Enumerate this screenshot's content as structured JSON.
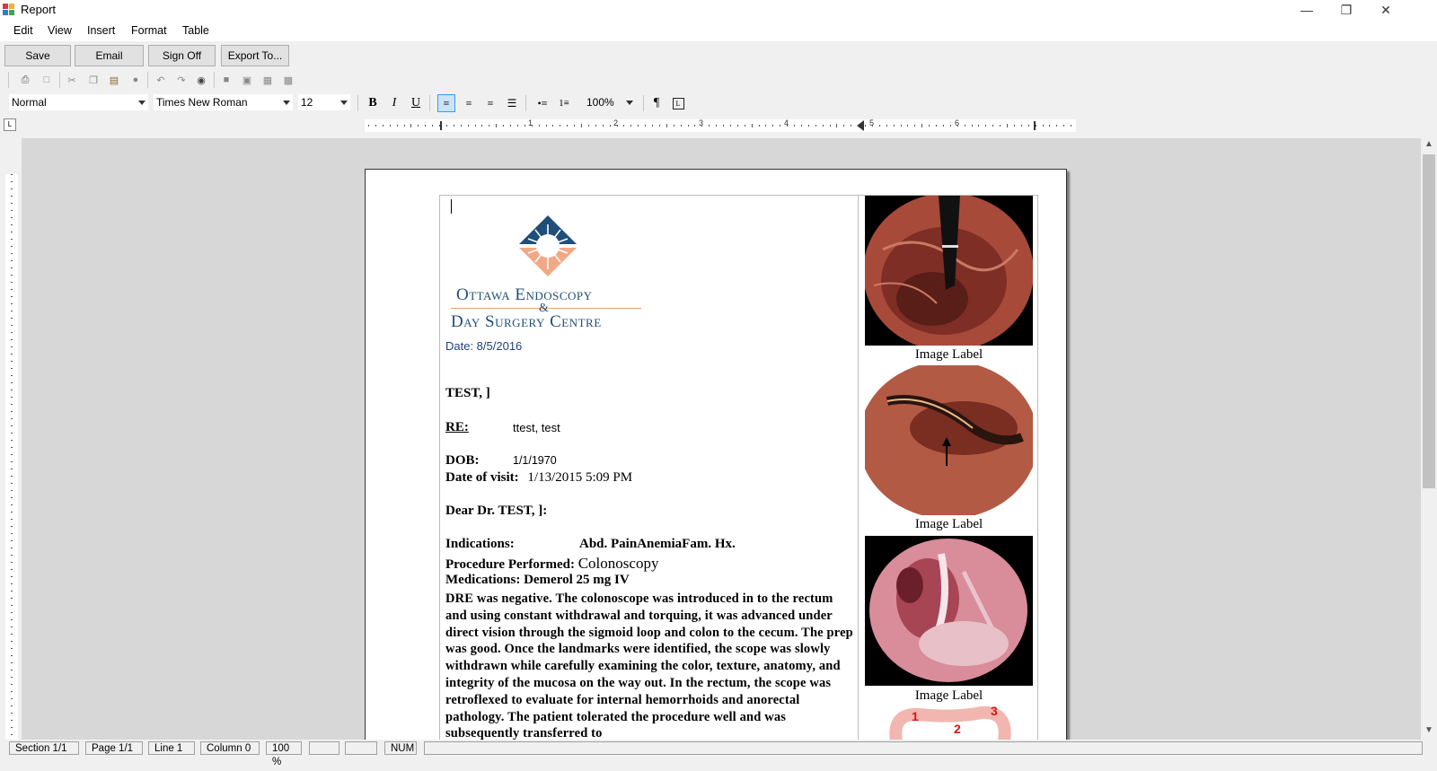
{
  "window": {
    "title": "Report"
  },
  "menu": [
    "Edit",
    "View",
    "Insert",
    "Format",
    "Table"
  ],
  "commands": [
    "Save",
    "Email",
    "Sign Off",
    "Export To..."
  ],
  "format_toolbar": {
    "style": "Normal",
    "font": "Times New Roman",
    "size": "12",
    "zoom": "100%"
  },
  "ruler_numbers": [
    "1",
    "2",
    "3",
    "4",
    "5",
    "6"
  ],
  "letterhead": {
    "line1": "Ottawa Endoscopy",
    "amp": "&",
    "line2": "Day Surgery Centre"
  },
  "report": {
    "date": "Date: 8/5/2016",
    "patient": "TEST, ]",
    "re_label": "RE:",
    "re_value": "ttest, test",
    "dob_label": "DOB:",
    "dob_value": "1/1/1970",
    "visit_label": "Date of visit:",
    "visit_value": "1/13/2015 5:09 PM",
    "greeting": "Dear Dr. TEST, ]:",
    "indications_label": "Indications:",
    "indications_value": "Abd. PainAnemiaFam. Hx.",
    "procedure_label": "Procedure Performed:",
    "procedure_value": "Colonoscopy",
    "medications": "Medications: Demerol 25 mg IV",
    "body": "DRE was negative. The colonoscope was introduced in to the rectum and using constant withdrawal and torquing, it was advanced under direct vision through the sigmoid loop and colon to the cecum. The prep was good.  Once the landmarks were identified, the scope was slowly withdrawn while carefully examining the color, texture, anatomy, and integrity of the mucosa on the way out. In the rectum, the scope was retroflexed to evaluate for internal hemorrhoids and anorectal pathology. The patient tolerated the procedure well and was subsequently transferred to"
  },
  "images": [
    {
      "label": "Image Label"
    },
    {
      "label": "Image Label"
    },
    {
      "label": "Image Label"
    }
  ],
  "diagram_numbers": [
    "1",
    "2",
    "3"
  ],
  "status": [
    "Section 1/1",
    "Page 1/1",
    "Line 1",
    "Column 0",
    "100 %",
    "",
    "",
    "NUM"
  ],
  "colors": {
    "logo_blue": "#1f4e79",
    "logo_peach": "#e6a07c",
    "selection": "#cce4f7"
  }
}
